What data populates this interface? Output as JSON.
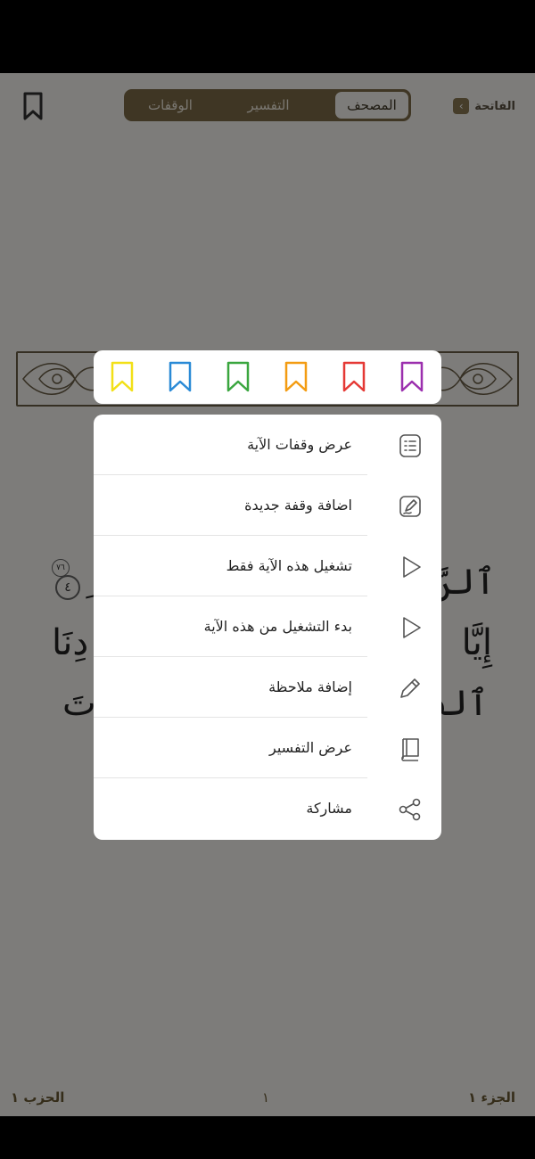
{
  "header": {
    "tabs": [
      {
        "label": "المصحف",
        "active": true
      },
      {
        "label": "التفسير",
        "active": false
      },
      {
        "label": "الوقفات",
        "active": false
      }
    ],
    "surah_name": "الفاتحة",
    "surah_chevron": "‹"
  },
  "quran": {
    "line1_right": "ٱلرَّحۡ",
    "line1_left": "ِ",
    "line2_right": "إِيَّا",
    "line2_left": "دِنَا",
    "line3_right": "ٱلصِّ",
    "line3_left": "تَ",
    "ayah_number": "٤",
    "ayah_small": "٧٦"
  },
  "footer": {
    "juz": "الجزء ١",
    "page": "١",
    "hizb": "الحزب ١"
  },
  "color_bookmarks": [
    {
      "name": "purple",
      "color": "#9b2fae"
    },
    {
      "name": "red",
      "color": "#e53935"
    },
    {
      "name": "orange",
      "color": "#f39c12"
    },
    {
      "name": "green",
      "color": "#3aa63f"
    },
    {
      "name": "blue",
      "color": "#2a8ad6"
    },
    {
      "name": "yellow",
      "color": "#f2e017"
    }
  ],
  "menu": {
    "items": [
      {
        "label": "عرض وقفات الآية",
        "icon": "list-doc-icon"
      },
      {
        "label": "اضافة وقفة جديدة",
        "icon": "add-note-icon"
      },
      {
        "label": "تشغيل هذه الآية فقط",
        "icon": "play-icon"
      },
      {
        "label": "بدء التشغيل من هذه الآية",
        "icon": "play-icon"
      },
      {
        "label": "إضافة ملاحظة",
        "icon": "pencil-icon"
      },
      {
        "label": "عرض التفسير",
        "icon": "book-icon"
      },
      {
        "label": "مشاركة",
        "icon": "share-icon"
      }
    ]
  },
  "colors": {
    "accent": "#7e6c48",
    "page_bg": "#fbf9f4"
  }
}
